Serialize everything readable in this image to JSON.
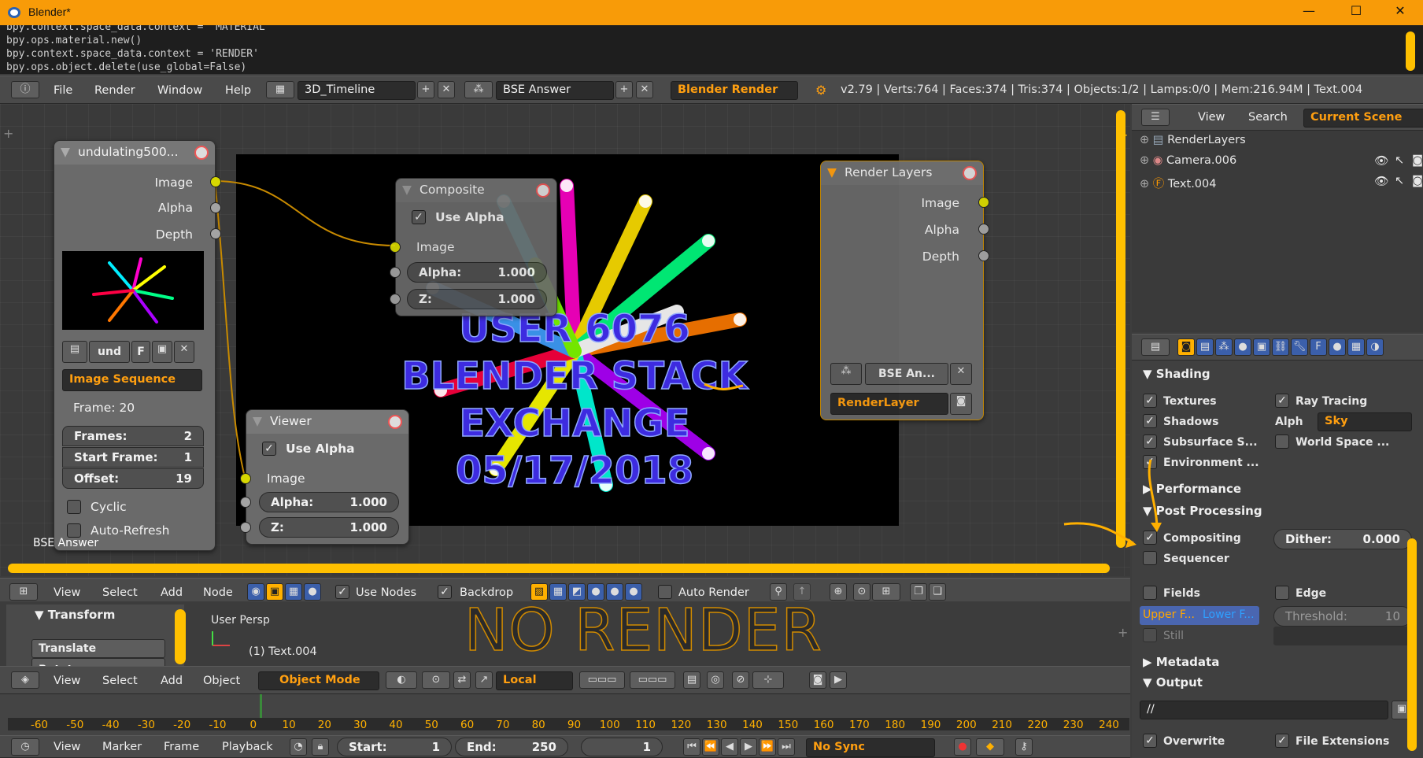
{
  "window": {
    "title": "Blender*",
    "minimize": "—",
    "maximize": "☐",
    "close": "✕"
  },
  "console": {
    "lines": [
      "bpy.context.space_data.context = 'MATERIAL'",
      "bpy.ops.material.new()",
      "bpy.context.space_data.context = 'RENDER'",
      "bpy.ops.object.delete(use_global=False)"
    ]
  },
  "info_header": {
    "menus": [
      "File",
      "Render",
      "Window",
      "Help"
    ],
    "screen_layout": "3D_Timeline",
    "scene": "BSE Answer",
    "engine": "Blender Render",
    "stats": "v2.79 | Verts:764 | Faces:374 | Tris:374 | Objects:1/2 | Lamps:0/0 | Mem:216.94M | Text.004"
  },
  "image_node": {
    "title": "undulating500...",
    "outputs": [
      "Image",
      "Alpha",
      "Depth"
    ],
    "image_name": "und",
    "f_label": "F",
    "source": "Image Sequence",
    "frame": "Frame: 20",
    "frames_label": "Frames:",
    "frames": "2",
    "start_frame_label": "Start Frame:",
    "start_frame": "1",
    "offset_label": "Offset:",
    "offset": "19",
    "cyclic": "Cyclic",
    "auto_refresh": "Auto-Refresh"
  },
  "composite_node": {
    "title": "Composite",
    "use_alpha": "Use Alpha",
    "input_image": "Image",
    "alpha_label": "Alpha:",
    "alpha": "1.000",
    "z_label": "Z:",
    "z": "1.000"
  },
  "viewer_node": {
    "title": "Viewer",
    "use_alpha": "Use Alpha",
    "input_image": "Image",
    "alpha_label": "Alpha:",
    "alpha": "1.000",
    "z_label": "Z:",
    "z": "1.000"
  },
  "render_layers_node": {
    "title": "Render Layers",
    "outputs": [
      "Image",
      "Alpha",
      "Depth"
    ],
    "scene": "BSE An...",
    "layer": "RenderLayer"
  },
  "backdrop_text": [
    "USER 6076",
    "BLENDER STACK",
    "EXCHANGE",
    "05/17/2018"
  ],
  "node_editor_label": "BSE Answer",
  "node_header": {
    "menus": [
      "View",
      "Select",
      "Add",
      "Node"
    ],
    "use_nodes": "Use Nodes",
    "backdrop": "Backdrop",
    "auto_render": "Auto Render"
  },
  "view3d": {
    "transform": "Transform",
    "translate": "Translate",
    "rotate": "Rotate",
    "persp": "User Persp",
    "object": "(1) Text.004",
    "overlay": "NO RENDER"
  },
  "view3d_header": {
    "menus": [
      "View",
      "Select",
      "Add",
      "Object"
    ],
    "mode": "Object Mode",
    "orientation": "Local"
  },
  "timeline": {
    "ticks": [
      "-60",
      "-50",
      "-40",
      "-30",
      "-20",
      "-10",
      "0",
      "10",
      "20",
      "30",
      "40",
      "50",
      "60",
      "70",
      "80",
      "90",
      "100",
      "110",
      "120",
      "130",
      "140",
      "150",
      "160",
      "170",
      "180",
      "190",
      "200",
      "210",
      "220",
      "230",
      "240"
    ],
    "menus": [
      "View",
      "Marker",
      "Frame",
      "Playback"
    ],
    "start_label": "Start:",
    "start": "1",
    "end_label": "End:",
    "end": "250",
    "current": "1",
    "sync": "No Sync"
  },
  "outliner": {
    "menus": [
      "View",
      "Search"
    ],
    "filter": "Current Scene",
    "items": [
      "RenderLayers",
      "Camera.006",
      "Text.004"
    ]
  },
  "properties": {
    "sections": {
      "shading": "Shading",
      "performance": "Performance",
      "post": "Post Processing",
      "metadata": "Metadata",
      "output": "Output"
    },
    "textures": "Textures",
    "ray_tracing": "Ray Tracing",
    "shadows": "Shadows",
    "alph": "Alph",
    "sky": "Sky",
    "sss": "Subsurface S...",
    "world_space": "World Space ...",
    "environment": "Environment ...",
    "compositing": "Compositing",
    "dither_label": "Dither:",
    "dither": "0.000",
    "sequencer": "Sequencer",
    "fields": "Fields",
    "edge": "Edge",
    "upper": "Upper F...",
    "lower": "Lower F...",
    "threshold_label": "Threshold:",
    "threshold": "10",
    "still": "Still",
    "output_path": "//",
    "overwrite": "Overwrite",
    "file_ext": "File Extensions"
  },
  "colors": {
    "title_bar": "#f89b08",
    "accent": "#ff9f10",
    "socket_yellow": "#d8d800",
    "link": "#c88a00"
  }
}
